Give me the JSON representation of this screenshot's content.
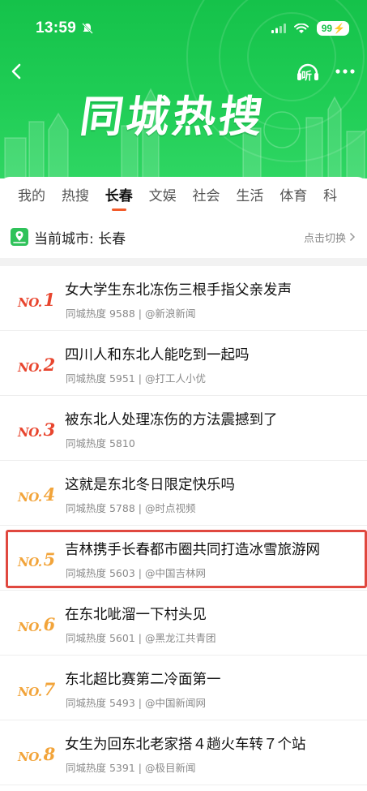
{
  "status": {
    "time": "13:59",
    "battery": "99"
  },
  "header": {
    "title": "同城热搜",
    "listen_label": "听"
  },
  "tabs": [
    {
      "label": "我的",
      "active": false
    },
    {
      "label": "热搜",
      "active": false
    },
    {
      "label": "长春",
      "active": true
    },
    {
      "label": "文娱",
      "active": false
    },
    {
      "label": "社会",
      "active": false
    },
    {
      "label": "生活",
      "active": false
    },
    {
      "label": "体育",
      "active": false
    },
    {
      "label": "科",
      "active": false
    }
  ],
  "city": {
    "label": "当前城市: 长春",
    "switch_label": "点击切换"
  },
  "items": [
    {
      "rank_prefix": "NO.",
      "rank": "1",
      "title": "女大学生东北冻伤三根手指父亲发声",
      "meta": "同城热度 9588 | @新浪新闻"
    },
    {
      "rank_prefix": "NO.",
      "rank": "2",
      "title": "四川人和东北人能吃到一起吗",
      "meta": "同城热度 5951 | @打工人小优"
    },
    {
      "rank_prefix": "NO.",
      "rank": "3",
      "title": "被东北人处理冻伤的方法震撼到了",
      "meta": "同城热度 5810"
    },
    {
      "rank_prefix": "NO.",
      "rank": "4",
      "title": "这就是东北冬日限定快乐吗",
      "meta": "同城热度 5788 | @时点视频"
    },
    {
      "rank_prefix": "NO.",
      "rank": "5",
      "title": "吉林携手长春都市圈共同打造冰雪旅游网",
      "meta": "同城热度 5603 | @中国吉林网"
    },
    {
      "rank_prefix": "NO.",
      "rank": "6",
      "title": "在东北呲溜一下村头见",
      "meta": "同城热度 5601 | @黑龙江共青团"
    },
    {
      "rank_prefix": "NO.",
      "rank": "7",
      "title": "东北超比赛第二冷面第一",
      "meta": "同城热度 5493 | @中国新闻网"
    },
    {
      "rank_prefix": "NO.",
      "rank": "8",
      "title": "女生为回东北老家搭４趟火车转７个站",
      "meta": "同城热度 5391 | @极目新闻"
    }
  ],
  "colors": {
    "brand_green": "#1fcd55",
    "rank_top": "#e8452e",
    "rank_other": "#f2a43a",
    "active_tab_underline": "#f25b2a",
    "highlight_border": "#e0483f"
  }
}
